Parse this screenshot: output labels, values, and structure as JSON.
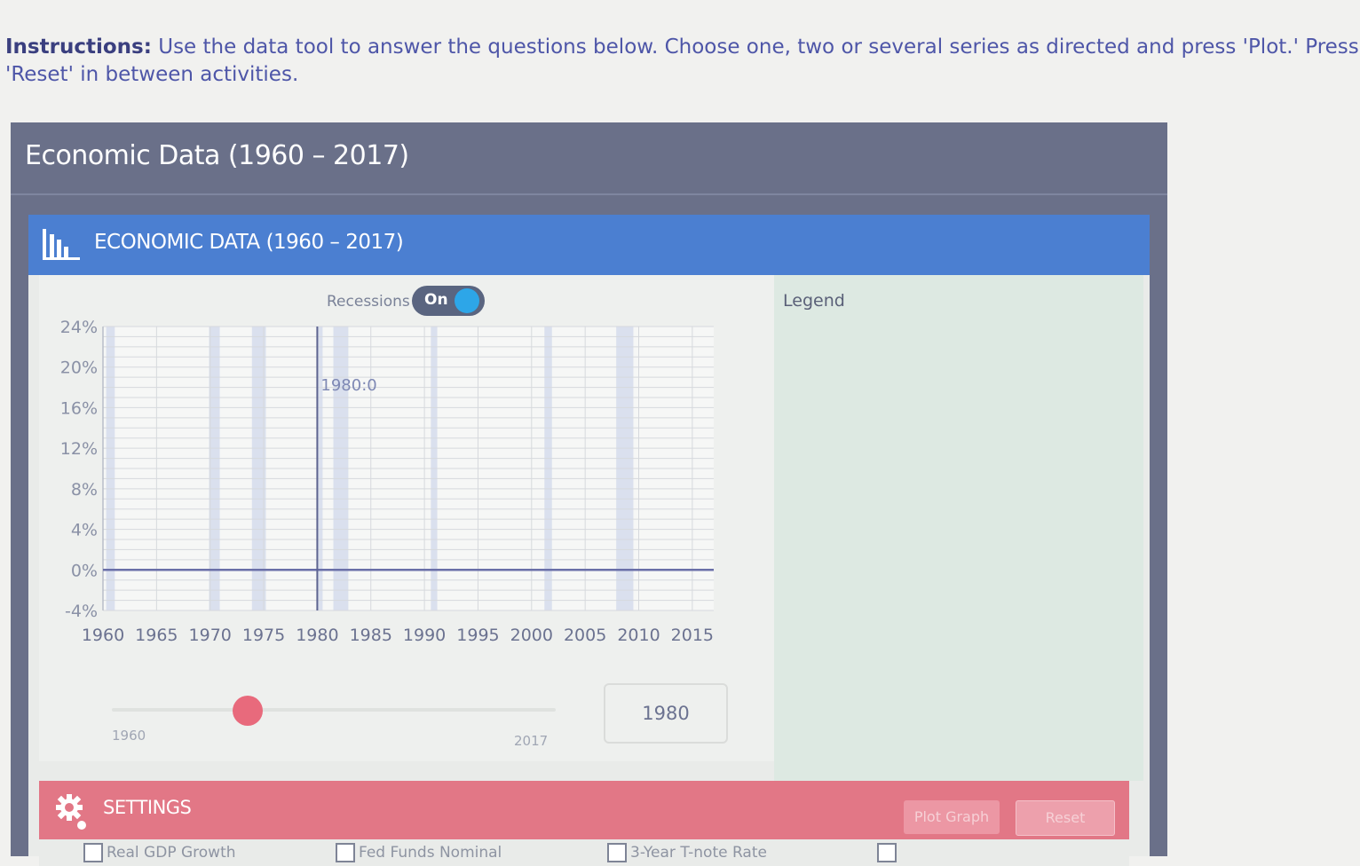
{
  "instructions": {
    "label": "Instructions:",
    "text": "Use the data tool to answer the questions below.  Choose one, two or several series as directed and press 'Plot.'  Press 'Reset' in between activities."
  },
  "panel": {
    "title": "Economic Data (1960 – 2017)"
  },
  "tool": {
    "header_title": "ECONOMIC DATA (1960 – 2017)",
    "icon": "bar-chart-icon"
  },
  "recessions": {
    "label": "Recessions",
    "toggle_state": "On"
  },
  "legend": {
    "title": "Legend"
  },
  "chart_data": {
    "type": "line",
    "title": "",
    "xlabel": "",
    "ylabel": "",
    "xlim": [
      1960,
      2017
    ],
    "ylim": [
      -4,
      24
    ],
    "x_ticks": [
      "1960",
      "1965",
      "1970",
      "1975",
      "1980",
      "1985",
      "1990",
      "1995",
      "2000",
      "2005",
      "2010",
      "2015"
    ],
    "y_ticks": [
      "24%",
      "20%",
      "16%",
      "12%",
      "8%",
      "4%",
      "0%",
      "-4%"
    ],
    "y_tick_values": [
      24,
      20,
      16,
      12,
      8,
      4,
      0,
      -4
    ],
    "grid": true,
    "baseline": 0,
    "recession_periods": [
      [
        1960.3,
        1961.1
      ],
      [
        1969.9,
        1970.9
      ],
      [
        1973.9,
        1975.2
      ],
      [
        1980.0,
        1980.5
      ],
      [
        1981.5,
        1982.9
      ],
      [
        1990.6,
        1991.2
      ],
      [
        2001.2,
        2001.9
      ],
      [
        2007.9,
        2009.5
      ]
    ],
    "cursor": {
      "year": 1980,
      "label": "1980:0"
    },
    "series": []
  },
  "slider": {
    "min_label": "1960",
    "max_label": "2017",
    "value": 1980
  },
  "year_box": {
    "value": "1980"
  },
  "settings": {
    "title": "SETTINGS",
    "plot_button": "Plot Graph",
    "reset_button": "Reset",
    "checkboxes": [
      "Real GDP Growth",
      "Fed Funds Nominal",
      "3-Year T-note Rate",
      ""
    ]
  },
  "colors": {
    "panel_bg": "#6a7089",
    "header_blue": "#4b7fd1",
    "settings_red": "#e27786",
    "toggle_knob": "#2da6e8",
    "slider_knob": "#e86a7c",
    "recession_band": "#d5dcec"
  }
}
